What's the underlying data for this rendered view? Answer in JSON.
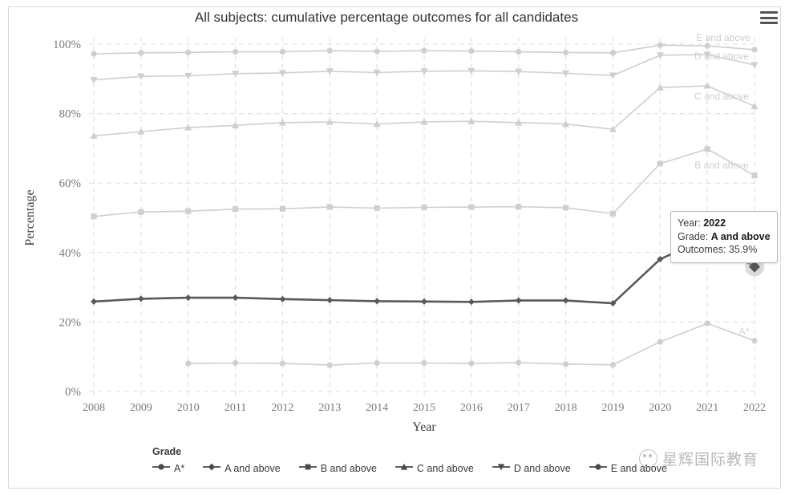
{
  "chart_title": "All subjects: cumulative percentage outcomes for all candidates",
  "menu": {
    "name": "hamburger-menu",
    "label": "≡"
  },
  "axes": {
    "x_label": "Year",
    "y_label": "Percentage",
    "x_ticks": [
      "2008",
      "2009",
      "2010",
      "2011",
      "2012",
      "2013",
      "2014",
      "2015",
      "2016",
      "2017",
      "2018",
      "2019",
      "2020",
      "2021",
      "2022"
    ],
    "y_ticks": [
      "0%",
      "20%",
      "40%",
      "60%",
      "80%",
      "100%"
    ]
  },
  "legend": {
    "title": "Grade",
    "items": [
      {
        "label": "A*",
        "marker": "circle"
      },
      {
        "label": "A and above",
        "marker": "diamond"
      },
      {
        "label": "B and above",
        "marker": "square"
      },
      {
        "label": "C and above",
        "marker": "triangle-up"
      },
      {
        "label": "D and above",
        "marker": "triangle-down"
      },
      {
        "label": "E and above",
        "marker": "circle"
      }
    ]
  },
  "tooltip": {
    "year_label": "Year:",
    "year_value": "2022",
    "grade_label": "Grade:",
    "grade_value": "A and above",
    "outcomes_label": "Outcomes:",
    "outcomes_value": "35.9%"
  },
  "series_end_labels": [
    {
      "text": "E and above"
    },
    {
      "text": "D and above"
    },
    {
      "text": "C and above"
    },
    {
      "text": "B and above"
    },
    {
      "text": "A and above"
    },
    {
      "text": "A*"
    }
  ],
  "watermark": {
    "text": "星辉国际教育"
  },
  "colors": {
    "highlight_series": "#595959",
    "muted_series": "#cfcfcf",
    "grid": "#dcdcdc",
    "axis_text": "#7a7a7a",
    "title_text": "#333333"
  },
  "chart_data": {
    "type": "line",
    "title": "All subjects: cumulative percentage outcomes for all candidates",
    "xlabel": "Year",
    "ylabel": "Percentage",
    "x": [
      2008,
      2009,
      2010,
      2011,
      2012,
      2013,
      2014,
      2015,
      2016,
      2017,
      2018,
      2019,
      2020,
      2021,
      2022
    ],
    "ylim": [
      0,
      100
    ],
    "xlim": [
      2008,
      2022
    ],
    "grid": true,
    "legend_position": "bottom-left",
    "series": [
      {
        "name": "E and above",
        "marker": "circle",
        "emphasis": false,
        "values": [
          97.2,
          97.5,
          97.6,
          97.8,
          97.8,
          98.1,
          97.9,
          98.1,
          98.0,
          97.8,
          97.6,
          97.5,
          99.7,
          99.5,
          98.4
        ]
      },
      {
        "name": "D and above",
        "marker": "triangle-down",
        "emphasis": false,
        "values": [
          89.7,
          90.7,
          90.9,
          91.5,
          91.7,
          92.2,
          91.8,
          92.2,
          92.3,
          92.1,
          91.6,
          91.0,
          96.8,
          97.0,
          94.0
        ]
      },
      {
        "name": "C and above",
        "marker": "triangle-up",
        "emphasis": false,
        "values": [
          73.6,
          74.8,
          76.0,
          76.6,
          77.4,
          77.6,
          77.0,
          77.6,
          77.8,
          77.4,
          77.0,
          75.5,
          87.5,
          88.0,
          82.1
        ]
      },
      {
        "name": "B and above",
        "marker": "square",
        "emphasis": false,
        "values": [
          50.4,
          51.7,
          51.9,
          52.5,
          52.6,
          53.1,
          52.8,
          53.0,
          53.1,
          53.2,
          52.9,
          51.2,
          65.6,
          69.8,
          62.2
        ]
      },
      {
        "name": "A and above",
        "marker": "diamond",
        "emphasis": true,
        "values": [
          25.9,
          26.7,
          27.0,
          27.0,
          26.6,
          26.3,
          26.0,
          25.9,
          25.8,
          26.2,
          26.2,
          25.4,
          38.1,
          44.3,
          35.9
        ]
      },
      {
        "name": "A*",
        "marker": "circle",
        "emphasis": false,
        "values": [
          null,
          null,
          8.1,
          8.2,
          8.1,
          7.6,
          8.2,
          8.2,
          8.1,
          8.3,
          7.9,
          7.7,
          14.3,
          19.6,
          14.6
        ]
      }
    ],
    "highlight_point": {
      "series": "A and above",
      "x": 2022,
      "y": 35.9
    }
  }
}
